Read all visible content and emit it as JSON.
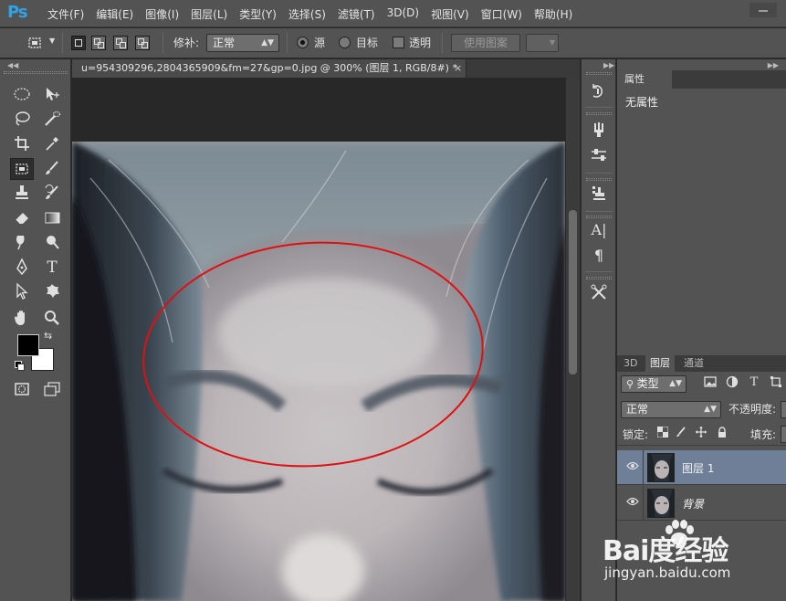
{
  "app": {
    "logo": "Ps",
    "menu": [
      "文件(F)",
      "编辑(E)",
      "图像(I)",
      "图层(L)",
      "类型(Y)",
      "选择(S)",
      "滤镜(T)",
      "3D(D)",
      "视图(V)",
      "窗口(W)",
      "帮助(H)"
    ]
  },
  "options_bar": {
    "tool_icon": "patch-tool-icon",
    "patch_label": "修补:",
    "patch_mode": "正常",
    "radio_source": "源",
    "radio_target": "目标",
    "radio_selected": "源",
    "transparent_label": "透明",
    "transparent_checked": false,
    "use_pattern_button": "使用图案"
  },
  "document": {
    "tab_title": "u=954309296,2804365909&fm=27&gp=0.jpg @ 300% (图层 1, RGB/8#) *",
    "close_glyph": "×",
    "annotation": "red-ellipse-around-forehead"
  },
  "tools": [
    "rectangular-marquee-icon",
    "move-icon",
    "lasso-icon",
    "quick-selection-icon",
    "crop-icon",
    "eyedropper-icon",
    "patch-tool-icon",
    "brush-icon",
    "clone-stamp-icon",
    "history-brush-icon",
    "eraser-icon",
    "gradient-icon",
    "blur-icon",
    "dodge-icon",
    "pen-icon",
    "type-icon",
    "path-selection-icon",
    "custom-shape-icon",
    "hand-icon",
    "zoom-icon",
    "quick-mask-icon",
    "screen-mode-icon"
  ],
  "colors": {
    "foreground": "#000000",
    "background": "#ffffff",
    "accent_logo": "#2fa3e7",
    "selected_layer": "#6f7f97",
    "annotation_red": "#e01010"
  },
  "properties_panel": {
    "tab": "属性",
    "empty_text": "无属性"
  },
  "layers_panel": {
    "tabs": [
      "3D",
      "图层",
      "通道"
    ],
    "active_tab": "图层",
    "filter_label": "类型",
    "blend_mode": "正常",
    "opacity_label": "不透明度:",
    "lock_label": "锁定:",
    "fill_label": "填充:",
    "layers": [
      {
        "name": "图层 1",
        "visible": true,
        "selected": true
      },
      {
        "name": "背景",
        "visible": true,
        "selected": false
      }
    ]
  },
  "watermark": {
    "brand": "Bai度经验",
    "url": "jingyan.baidu.com"
  }
}
